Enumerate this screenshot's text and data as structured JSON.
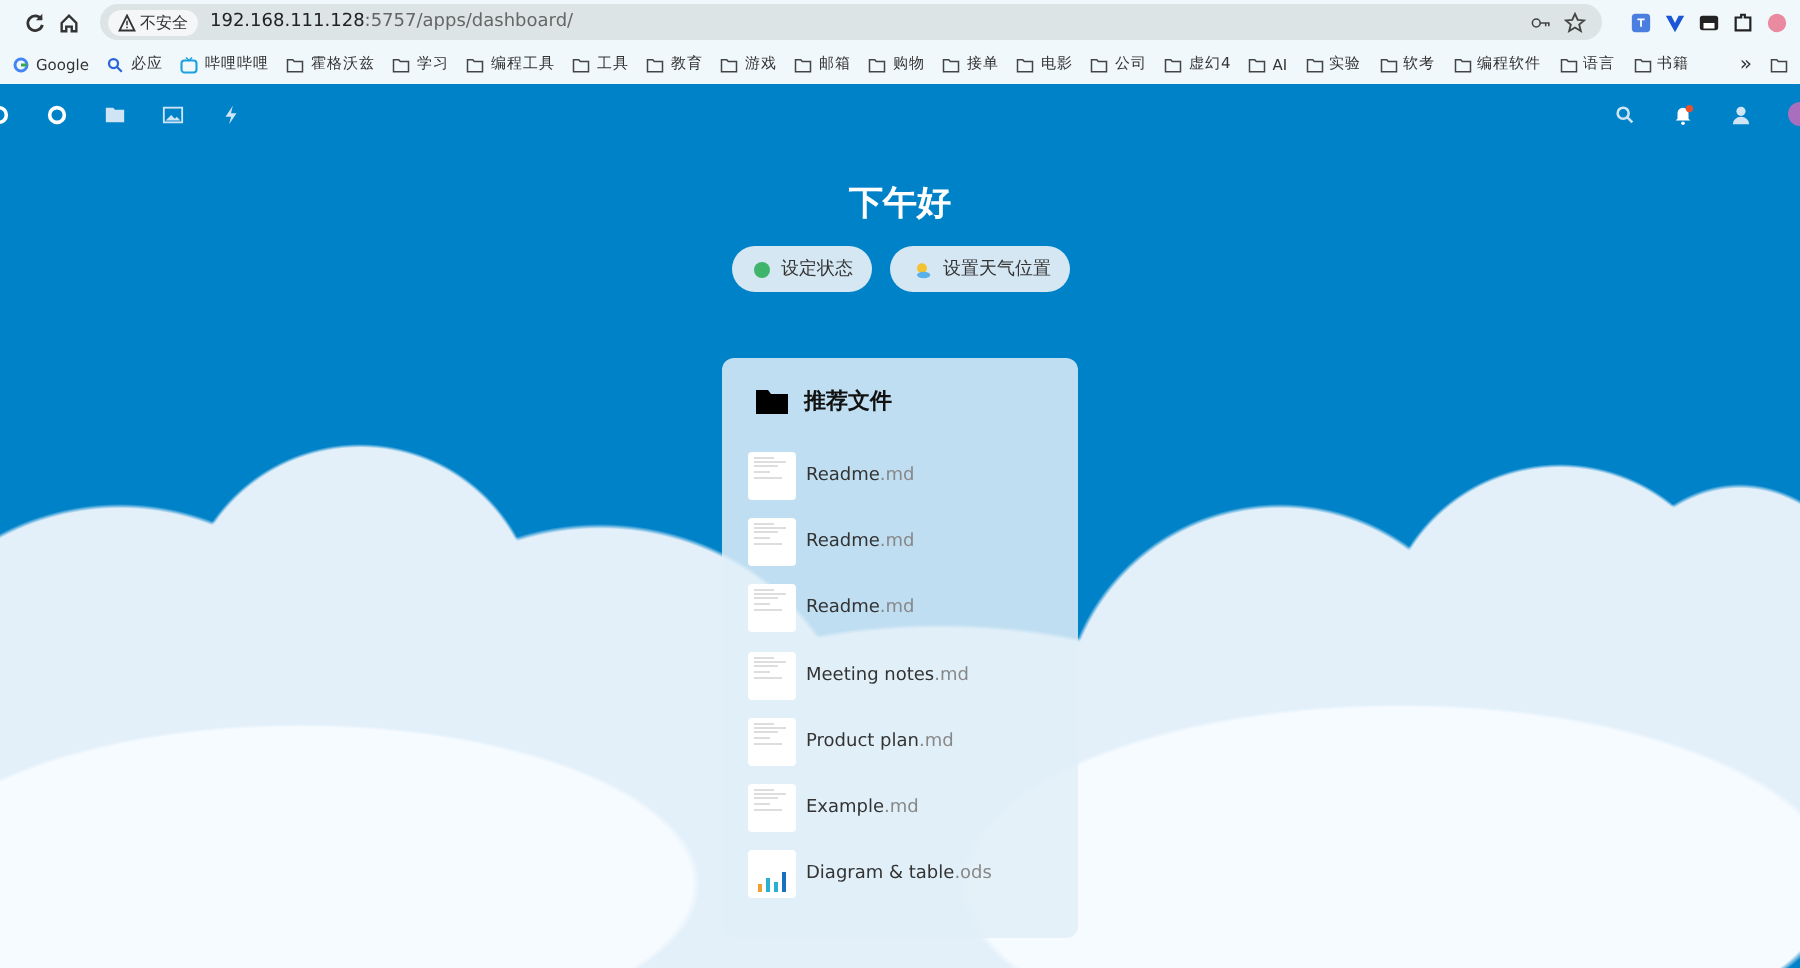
{
  "browser": {
    "security_label": "不安全",
    "url_host": "192.168.111.128",
    "url_path": ":5757/apps/dashboard/"
  },
  "bookmarks": [
    {
      "kind": "google",
      "label": "Google"
    },
    {
      "kind": "search",
      "label": "必应"
    },
    {
      "kind": "tv",
      "label": "哔哩哔哩"
    },
    {
      "kind": "folder",
      "label": "霍格沃兹"
    },
    {
      "kind": "folder",
      "label": "学习"
    },
    {
      "kind": "folder",
      "label": "编程工具"
    },
    {
      "kind": "folder",
      "label": "工具"
    },
    {
      "kind": "folder",
      "label": "教育"
    },
    {
      "kind": "folder",
      "label": "游戏"
    },
    {
      "kind": "folder",
      "label": "邮箱"
    },
    {
      "kind": "folder",
      "label": "购物"
    },
    {
      "kind": "folder",
      "label": "接单"
    },
    {
      "kind": "folder",
      "label": "电影"
    },
    {
      "kind": "folder",
      "label": "公司"
    },
    {
      "kind": "folder",
      "label": "虚幻4"
    },
    {
      "kind": "folder",
      "label": "AI"
    },
    {
      "kind": "folder",
      "label": "实验"
    },
    {
      "kind": "folder",
      "label": "软考"
    },
    {
      "kind": "folder",
      "label": "编程软件"
    },
    {
      "kind": "folder",
      "label": "语言"
    },
    {
      "kind": "folder",
      "label": "书籍"
    }
  ],
  "bookmarks_more": "»",
  "greeting": "下午好",
  "status_buttons": [
    {
      "kind": "status",
      "label": "设定状态",
      "color": "#3fb56c"
    },
    {
      "kind": "weather",
      "label": "设置天气位置"
    }
  ],
  "recommended": {
    "title": "推荐文件",
    "files": [
      {
        "name": "Readme",
        "ext": ".md",
        "kind": "doc"
      },
      {
        "name": "Readme",
        "ext": ".md",
        "kind": "doc"
      },
      {
        "name": "Readme",
        "ext": ".md",
        "kind": "doc"
      },
      {
        "name": "Meeting notes",
        "ext": ".md",
        "kind": "doc"
      },
      {
        "name": "Product plan",
        "ext": ".md",
        "kind": "doc"
      },
      {
        "name": "Example",
        "ext": ".md",
        "kind": "doc"
      },
      {
        "name": "Diagram & table",
        "ext": ".ods",
        "kind": "sheet"
      }
    ]
  }
}
